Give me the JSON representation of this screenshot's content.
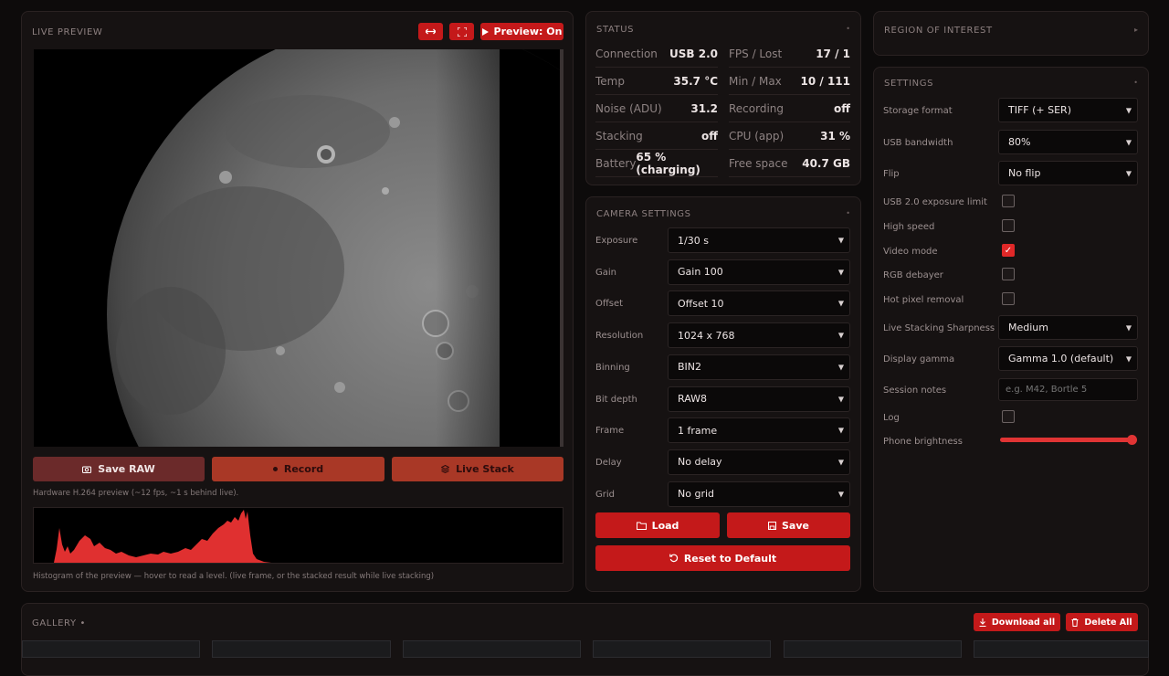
{
  "preview": {
    "title": "LIVE PREVIEW",
    "toggle_label": "Preview: On",
    "save_raw": "Save RAW",
    "record": "Record",
    "live_stack": "Live Stack",
    "note": "Hardware H.264 preview (~12 fps, ~1 s behind live).",
    "hist_caption": "Histogram of the preview — hover to read a level. (live frame, or the stacked result while live stacking)"
  },
  "status": {
    "title": "STATUS",
    "rows": [
      {
        "l1": "Connection",
        "v1": "USB 2.0",
        "l2": "FPS / Lost",
        "v2": "17 / 1"
      },
      {
        "l1": "Temp",
        "v1": "35.7 °C",
        "l2": "Min / Max",
        "v2": "10 / 111"
      },
      {
        "l1": "Noise (ADU)",
        "v1": "31.2",
        "l2": "Recording",
        "v2": "off"
      },
      {
        "l1": "Stacking",
        "v1": "off",
        "l2": "CPU (app)",
        "v2": "31 %"
      },
      {
        "l1": "Battery",
        "v1": "65 % (charging)",
        "l2": "Free space",
        "v2": "40.7 GB"
      }
    ]
  },
  "camera": {
    "title": "CAMERA SETTINGS",
    "fields": [
      {
        "label": "Exposure",
        "value": "1/30 s"
      },
      {
        "label": "Gain",
        "value": "Gain 100"
      },
      {
        "label": "Offset",
        "value": "Offset 10"
      },
      {
        "label": "Resolution",
        "value": "1024 x 768"
      },
      {
        "label": "Binning",
        "value": "BIN2"
      },
      {
        "label": "Bit depth",
        "value": "RAW8"
      },
      {
        "label": "Frame",
        "value": "1 frame"
      },
      {
        "label": "Delay",
        "value": "No delay"
      },
      {
        "label": "Grid",
        "value": "No grid"
      }
    ],
    "load": "Load",
    "save": "Save",
    "reset": "Reset to Default"
  },
  "roi": {
    "title": "REGION OF INTEREST"
  },
  "settings": {
    "title": "SETTINGS",
    "storage_format": {
      "label": "Storage format",
      "value": "TIFF (+ SER)"
    },
    "usb_bandwidth": {
      "label": "USB bandwidth",
      "value": "80%"
    },
    "flip": {
      "label": "Flip",
      "value": "No flip"
    },
    "checks": [
      {
        "label": "USB 2.0 exposure limit",
        "checked": false
      },
      {
        "label": "High speed",
        "checked": false
      },
      {
        "label": "Video mode",
        "checked": true
      },
      {
        "label": "RGB debayer",
        "checked": false
      },
      {
        "label": "Hot pixel removal",
        "checked": false
      }
    ],
    "sharpness": {
      "label": "Live Stacking Sharpness",
      "value": "Medium"
    },
    "gamma": {
      "label": "Display gamma",
      "value": "Gamma 1.0 (default)"
    },
    "notes": {
      "label": "Session notes",
      "placeholder": "e.g. M42, Bortle 5"
    },
    "log": {
      "label": "Log",
      "checked": false
    },
    "brightness": {
      "label": "Phone brightness",
      "level": 0.98
    }
  },
  "gallery": {
    "title": "GALLERY",
    "download_all": "Download all",
    "delete_all": "Delete All"
  },
  "colors": {
    "accent": "#c4191a",
    "record_btn": "#a93826",
    "save_raw_btn": "#6b2a2a"
  }
}
